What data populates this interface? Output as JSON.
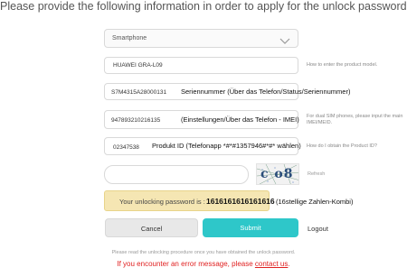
{
  "page": {
    "heading": "Please provide the following information in order to apply for the unlock password."
  },
  "form": {
    "device_type": {
      "value": "Smartphone",
      "icon": "chevron-down-icon"
    },
    "product_model": {
      "value": "HUAWEI GRA-L09",
      "hint": "How to enter the product model."
    },
    "serial": {
      "value": "S7M4315A28000131",
      "annotation": "Seriennummer (Über das Telefon/Status/Seriennummer)"
    },
    "imei": {
      "value": "947893210216135",
      "annotation": "(Einstellungen/Über das Telefon - IMEI)",
      "hint_line1": "For dual SIM phones, please input the main",
      "hint_line2": "IMEI/MEID."
    },
    "product_id": {
      "value": "02347538",
      "annotation": "Produkt ID (Telefonapp  *#*#1357946#*#* wählen)",
      "hint": "How do I obtain the Product ID?"
    },
    "captcha": {
      "input_value": "",
      "image_text": "c o8",
      "refresh_label": "Refresh"
    },
    "result": {
      "label": "Your unlocking password is :",
      "password": "1616161616161616",
      "annotation": "(16stellige Zahlen-Kombi)"
    }
  },
  "actions": {
    "cancel_label": "Cancel",
    "submit_label": "Submit",
    "logout_label": "Logout"
  },
  "footer": {
    "note": "Please read the unlocking procedure once you have obtained the unlock password.",
    "error_prefix": "If you encounter an error message, please ",
    "contact_link": "contact us",
    "error_suffix": "."
  },
  "colors": {
    "accent": "#2ec7c9",
    "result_bg": "#f5e6b3",
    "error": "#e02020"
  }
}
